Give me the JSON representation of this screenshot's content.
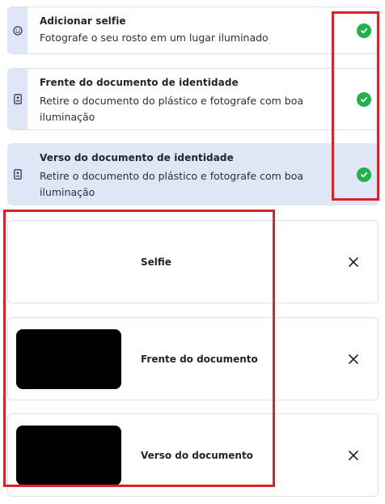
{
  "steps": [
    {
      "title": "Adicionar selfie",
      "desc": "Fotografe o seu rosto em um lugar iluminado",
      "icon": "smiley-icon",
      "done": true
    },
    {
      "title": "Frente do documento de identidade",
      "desc": "Retire o documento do plástico e fotografe com boa iluminação",
      "icon": "id-card-icon",
      "done": true
    },
    {
      "title": "Verso do documento de identidade",
      "desc": "Retire o documento do plástico e fotografe com boa iluminação",
      "icon": "id-card-icon",
      "done": true
    }
  ],
  "uploads": [
    {
      "label": "Selfie",
      "has_thumb": false
    },
    {
      "label": "Frente do documento",
      "has_thumb": true
    },
    {
      "label": "Verso do documento",
      "has_thumb": true
    }
  ],
  "colors": {
    "accent": "#dfe7f6",
    "check": "#22b24c",
    "highlight": "#d8232a"
  }
}
